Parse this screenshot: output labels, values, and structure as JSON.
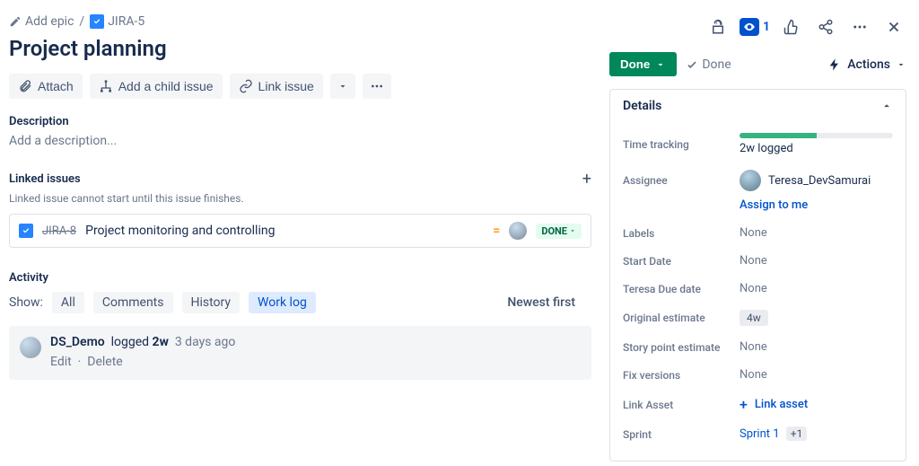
{
  "breadcrumb": {
    "add_epic": "Add epic",
    "issue_key": "JIRA-5"
  },
  "top_actions": {
    "watch_count": "1"
  },
  "title": "Project planning",
  "toolbar": {
    "attach": "Attach",
    "add_child": "Add a child issue",
    "link_issue": "Link issue"
  },
  "description": {
    "label": "Description",
    "placeholder": "Add a description..."
  },
  "linked": {
    "label": "Linked issues",
    "subtext": "Linked issue cannot start until this issue finishes.",
    "items": [
      {
        "key": "JIRA-8",
        "summary": "Project monitoring and controlling",
        "status": "DONE"
      }
    ]
  },
  "activity": {
    "label": "Activity",
    "show_label": "Show:",
    "tabs": {
      "all": "All",
      "comments": "Comments",
      "history": "History",
      "worklog": "Work log"
    },
    "sort": "Newest first",
    "entry": {
      "author": "DS_Demo",
      "action": "logged",
      "duration": "2w",
      "ago": "3 days ago",
      "edit": "Edit",
      "delete": "Delete"
    }
  },
  "status": {
    "current": "Done",
    "done_label": "Done",
    "actions": "Actions"
  },
  "details": {
    "header": "Details",
    "time_tracking": {
      "label": "Time tracking",
      "text": "2w logged",
      "percent": 50
    },
    "assignee": {
      "label": "Assignee",
      "name": "Teresa_DevSamurai",
      "assign_to_me": "Assign to me"
    },
    "labels": {
      "label": "Labels",
      "value": "None"
    },
    "start_date": {
      "label": "Start Date",
      "value": "None"
    },
    "teresa_due": {
      "label": "Teresa Due date",
      "value": "None"
    },
    "orig_estimate": {
      "label": "Original estimate",
      "value": "4w"
    },
    "story_points": {
      "label": "Story point estimate",
      "value": "None"
    },
    "fix_versions": {
      "label": "Fix versions",
      "value": "None"
    },
    "link_asset": {
      "label": "Link Asset",
      "action": "Link asset"
    },
    "sprint": {
      "label": "Sprint",
      "value": "Sprint 1",
      "extra": "+1"
    }
  }
}
